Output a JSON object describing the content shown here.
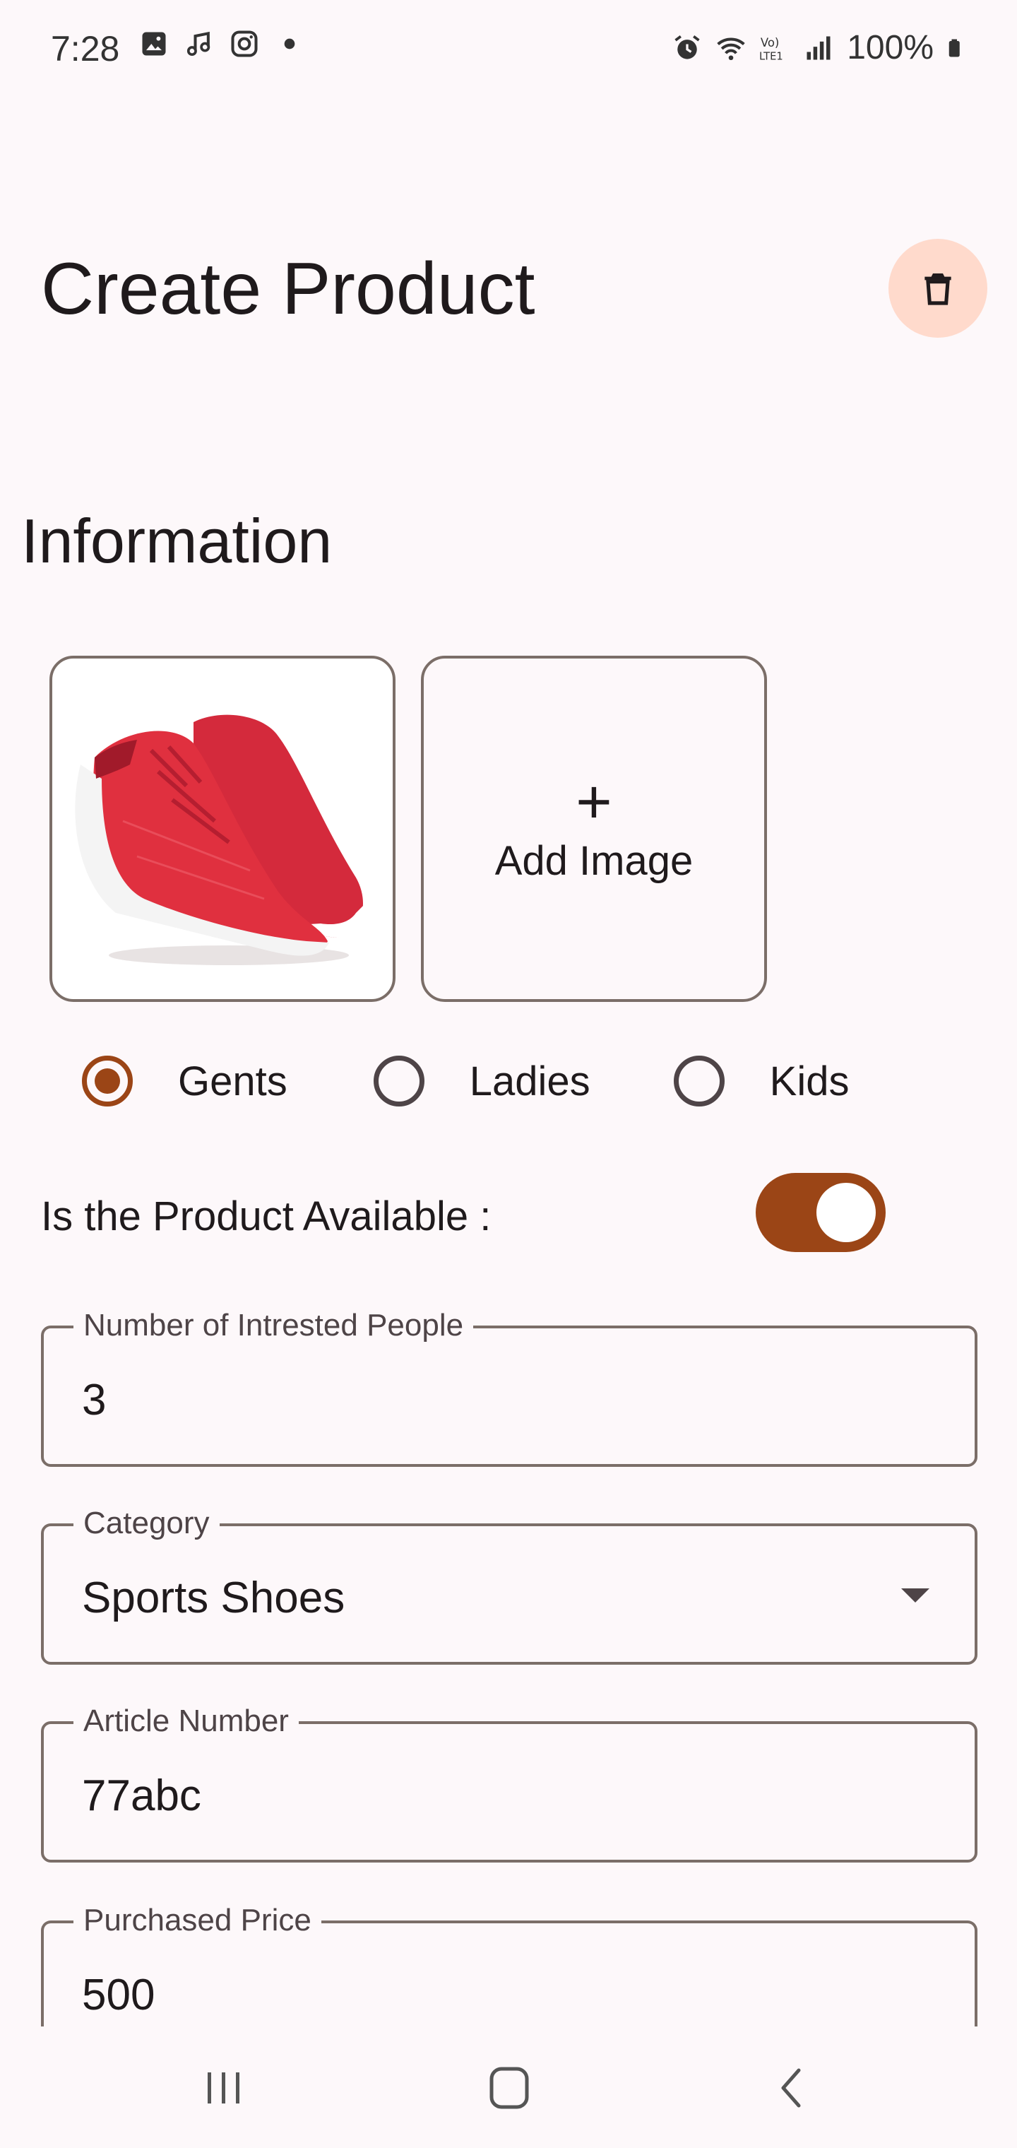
{
  "status_bar": {
    "time": "7:28",
    "battery": "100%",
    "left_icons": [
      "gallery-icon",
      "music-note-icon",
      "instagram-icon",
      "dot-icon"
    ],
    "right_icons": [
      "alarm-icon",
      "wifi-icon",
      "volte-icon",
      "signal-icon",
      "battery-icon"
    ]
  },
  "header": {
    "title": "Create Product",
    "delete_icon": "trash-icon"
  },
  "section": {
    "title": "Information"
  },
  "images": {
    "add_label": "Add Image",
    "add_symbol": "+"
  },
  "gender": {
    "options": [
      "Gents",
      "Ladies",
      "Kids"
    ],
    "selected": "Gents"
  },
  "availability": {
    "label": "Is the Product Available :",
    "value": true
  },
  "fields": {
    "interested": {
      "label": "Number of Intrested People",
      "value": "3"
    },
    "category": {
      "label": "Category",
      "value": "Sports Shoes"
    },
    "article": {
      "label": "Article Number",
      "value": "77abc"
    },
    "purchased_price": {
      "label": "Purchased Price",
      "value": "500"
    }
  },
  "colors": {
    "accent": "#9b4516",
    "delete_bg": "#ffdacc",
    "background": "#fdf8fa",
    "outline": "#7b6e68"
  }
}
